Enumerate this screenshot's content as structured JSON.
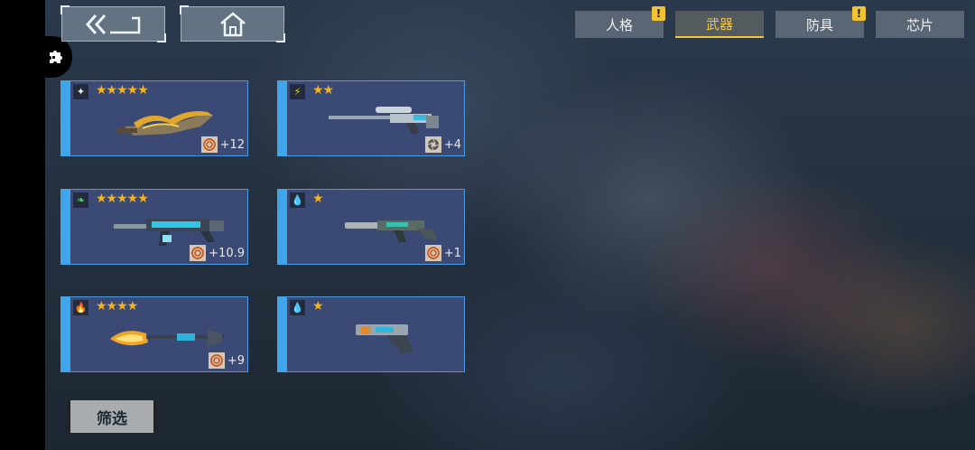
{
  "nav": {
    "back_icon": "double-chevron-left-icon",
    "home_icon": "home-icon"
  },
  "tabs": [
    {
      "label": "人格",
      "alert": "!",
      "active": false
    },
    {
      "label": "武器",
      "alert": "",
      "active": true
    },
    {
      "label": "防具",
      "alert": "!",
      "active": false
    },
    {
      "label": "芯片",
      "alert": "",
      "active": false
    }
  ],
  "weapons": [
    {
      "element": "light",
      "element_glyph": "✦",
      "stars": "★★★★★",
      "upgrade_icon": "spiral-icon",
      "upgrade": "+12"
    },
    {
      "element": "lightning",
      "element_glyph": "⚡",
      "stars": "★★",
      "upgrade_icon": "aperture-icon",
      "upgrade": "+4"
    },
    {
      "element": "wind",
      "element_glyph": "❧",
      "stars": "★★★★★",
      "upgrade_icon": "spiral-icon",
      "upgrade": "+10.9"
    },
    {
      "element": "water",
      "element_glyph": "💧",
      "stars": "★",
      "upgrade_icon": "spiral-icon",
      "upgrade": "+1"
    },
    {
      "element": "fire",
      "element_glyph": "🔥",
      "stars": "★★★★",
      "upgrade_icon": "spiral-icon",
      "upgrade": "+9"
    },
    {
      "element": "water",
      "element_glyph": "💧",
      "stars": "★",
      "upgrade_icon": "",
      "upgrade": ""
    }
  ],
  "filter": {
    "label": "筛选"
  },
  "colors": {
    "accent": "#f4c63a",
    "card_border": "#4c9be4",
    "card_bg": "#3a4a74",
    "star": "#f5b21d"
  }
}
